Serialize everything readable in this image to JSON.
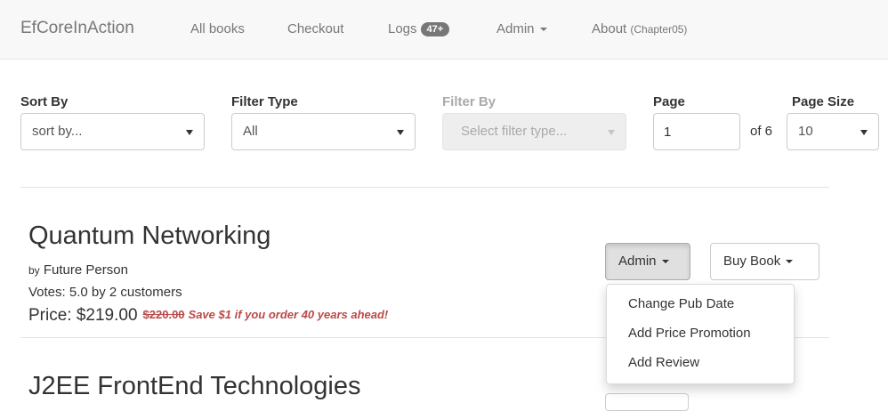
{
  "navbar": {
    "brand": "EfCoreInAction",
    "all_books": "All books",
    "checkout": "Checkout",
    "logs": "Logs",
    "logs_badge": "47+",
    "admin": "Admin",
    "about": "About",
    "about_suffix": "(Chapter05)"
  },
  "controls": {
    "sort_by": {
      "label": "Sort By",
      "value": "sort by..."
    },
    "filter_type": {
      "label": "Filter Type",
      "value": "All"
    },
    "filter_by": {
      "label": "Filter By",
      "value": "Select filter type..."
    },
    "page": {
      "label": "Page",
      "value": "1",
      "of_text": "of 6"
    },
    "page_size": {
      "label": "Page Size",
      "value": "10"
    }
  },
  "books": [
    {
      "title": "Quantum Networking",
      "by_word": "by",
      "author": "Future Person",
      "votes": "Votes: 5.0 by 2 customers",
      "price": "Price: $219.00",
      "old_price": "$220.00",
      "promotion": "Save $1 if you order 40 years ahead!"
    },
    {
      "title": "J2EE FrontEnd Technologies"
    }
  ],
  "admin_button": {
    "label": "Admin"
  },
  "buy_button": {
    "label": "Buy Book"
  },
  "admin_menu": [
    "Change Pub Date",
    "Add Price Promotion",
    "Add Review"
  ]
}
